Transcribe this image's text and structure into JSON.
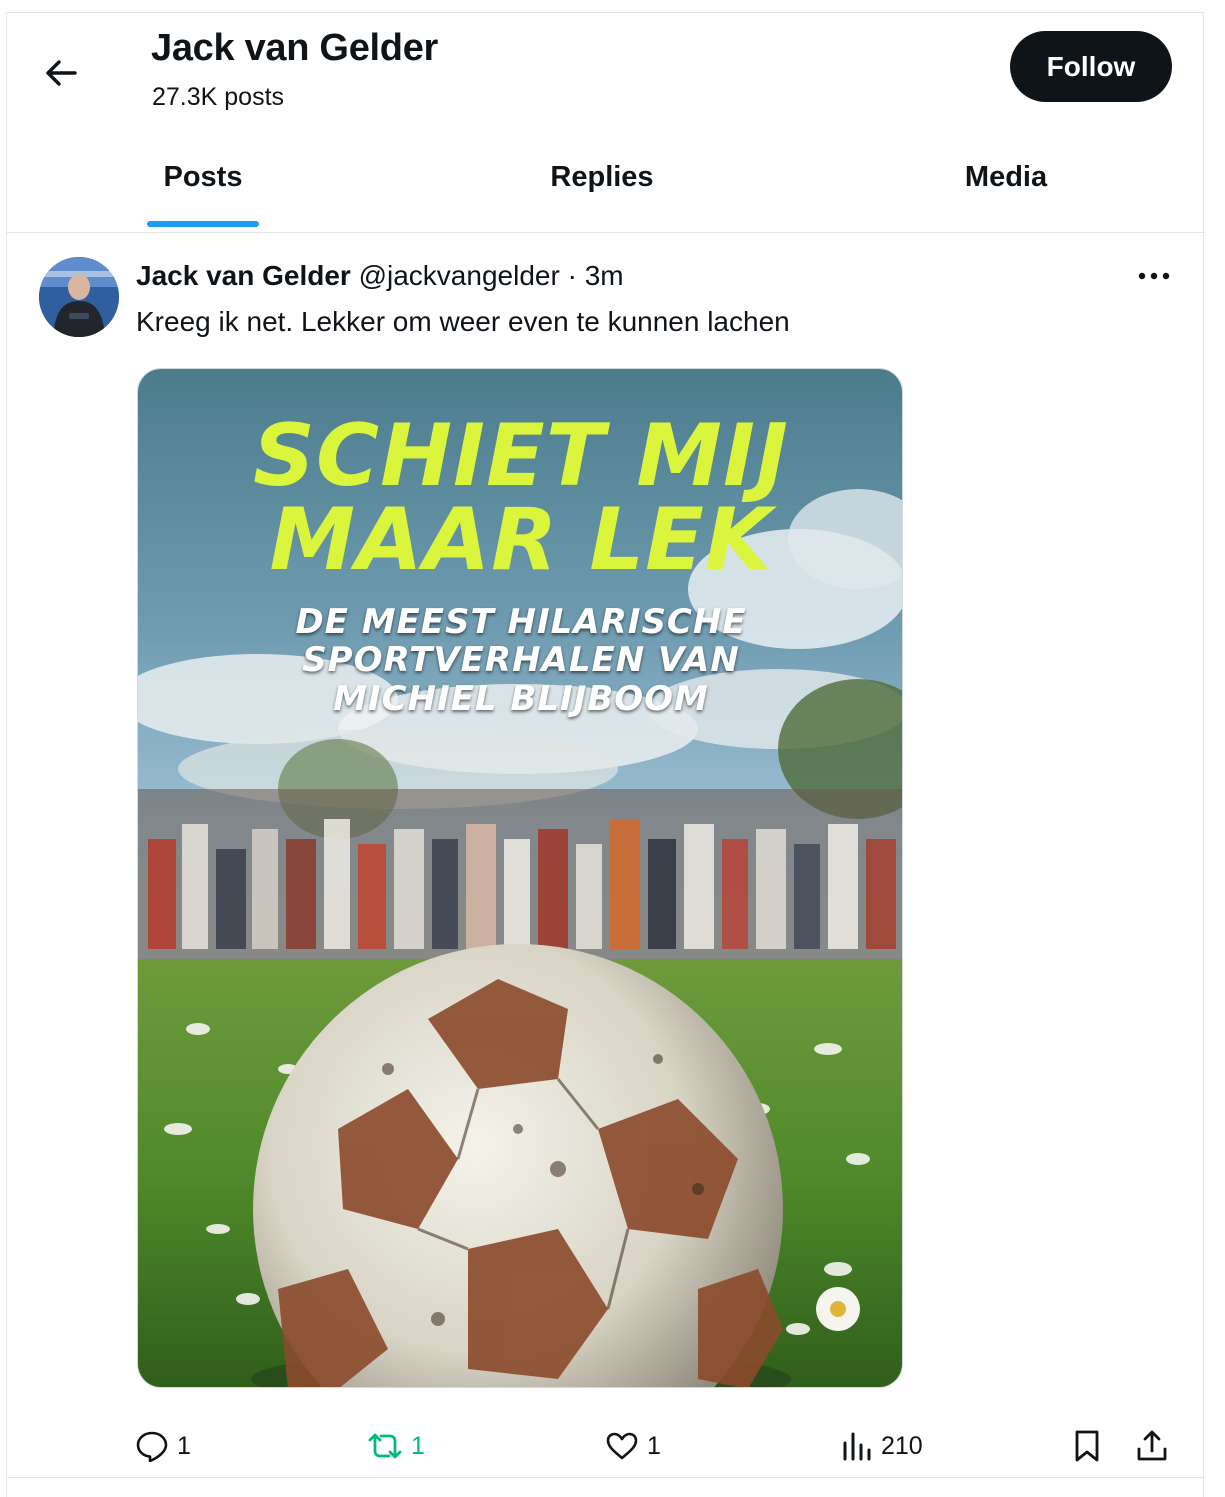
{
  "header": {
    "title": "Jack van Gelder",
    "subtitle": "27.3K posts",
    "follow_label": "Follow",
    "back_icon": "arrow-left-icon"
  },
  "tabs": [
    {
      "label": "Posts",
      "active": true
    },
    {
      "label": "Replies",
      "active": false
    },
    {
      "label": "Media",
      "active": false
    }
  ],
  "post": {
    "author_name": "Jack van Gelder",
    "handle": "@jackvangelder",
    "separator": "·",
    "time": "3m",
    "text": "Kreeg ik net. Lekker om weer even te kunnen lachen",
    "media": {
      "title_line1": "SCHIET MIJ",
      "title_line2": "MAAR LEK",
      "sub_line1": "DE MEEST HILARISCHE",
      "sub_line2": "SPORTVERHALEN VAN",
      "sub_line3": "MICHIEL BLIJBOOM"
    },
    "actions": {
      "replies": "1",
      "reposts": "1",
      "likes": "1",
      "views": "210"
    }
  },
  "colors": {
    "accent": "#1d9bf0",
    "repost_active": "#00ba7c",
    "cover_title": "#dbf53d",
    "text_primary": "#0f1419",
    "text_secondary": "#536471"
  }
}
